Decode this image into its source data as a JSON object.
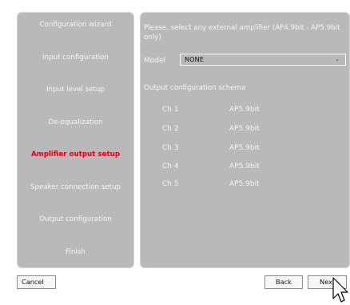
{
  "steps": [
    {
      "label": "Configuration wizard",
      "active": false
    },
    {
      "label": "Input configuration",
      "active": false
    },
    {
      "label": "Input level setup",
      "active": false
    },
    {
      "label": "De-equalization",
      "active": false
    },
    {
      "label": "Amplifier output setup",
      "active": true
    },
    {
      "label": "Speaker connection setup",
      "active": false
    },
    {
      "label": "Output configuration",
      "active": false
    },
    {
      "label": "Finish",
      "active": false
    }
  ],
  "content": {
    "prompt": "Please, select any external amplifier (AP4.9bit - AP5.9bit only)",
    "model_label": "Model",
    "model_value": "NONE",
    "schema_title": "Output configuration schema",
    "channels": [
      {
        "name": "Ch 1",
        "amp": "AP5.9bit"
      },
      {
        "name": "Ch 2",
        "amp": "AP5.9bit"
      },
      {
        "name": "Ch 3",
        "amp": "AP5.9bit"
      },
      {
        "name": "Ch 4",
        "amp": "AP5.9bit"
      },
      {
        "name": "Ch 5",
        "amp": "AP5.9bit"
      }
    ]
  },
  "buttons": {
    "cancel": "Cancel",
    "back": "Back",
    "next": "Next"
  },
  "colors": {
    "panel": "#b9b9b9",
    "active_step": "#e0001b",
    "text": "#f5f5f5"
  }
}
